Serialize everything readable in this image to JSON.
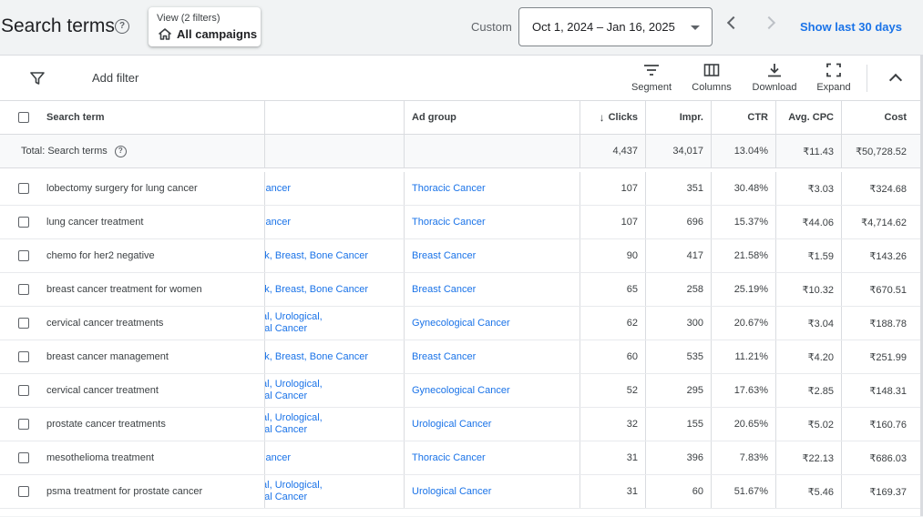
{
  "header": {
    "title": "Search terms",
    "help_glyph": "?",
    "view_label": "View (2 filters)",
    "view_value": "All campaigns",
    "custom_label": "Custom",
    "date_range": "Oct 1, 2024 – Jan 16, 2025",
    "show_last": "Show last 30 days"
  },
  "toolbar": {
    "add_filter": "Add filter",
    "segment": "Segment",
    "columns": "Columns",
    "download": "Download",
    "expand": "Expand"
  },
  "table": {
    "columns": {
      "search_term": "Search term",
      "ad_group": "Ad group",
      "clicks": "Clicks",
      "impr": "Impr.",
      "ctr": "CTR",
      "avg_cpc": "Avg. CPC",
      "cost": "Cost"
    },
    "sort_glyph": "↓",
    "total": {
      "label": "Total: Search terms",
      "clicks": "4,437",
      "impr": "34,017",
      "ctr": "13.04%",
      "avg_cpc": "₹11.43",
      "cost": "₹50,728.52"
    },
    "rows": [
      {
        "term": "lobectomy surgery for lung cancer",
        "camp1": "Cancer",
        "camp2": "",
        "ad_group": "Thoracic Cancer",
        "clicks": "107",
        "impr": "351",
        "ctr": "30.48%",
        "cpc": "₹3.03",
        "cost": "₹324.68"
      },
      {
        "term": "lung cancer treatment",
        "camp1": "Cancer",
        "camp2": "",
        "ad_group": "Thoracic Cancer",
        "clicks": "107",
        "impr": "696",
        "ctr": "15.37%",
        "cpc": "₹44.06",
        "cost": "₹4,714.62"
      },
      {
        "term": "chemo for her2 negative",
        "camp1": "eck, Breast, Bone Cancer",
        "camp2": "",
        "ad_group": "Breast Cancer",
        "clicks": "90",
        "impr": "417",
        "ctr": "21.58%",
        "cpc": "₹1.59",
        "cost": "₹143.26"
      },
      {
        "term": "breast cancer treatment for women",
        "camp1": "eck, Breast, Bone Cancer",
        "camp2": "",
        "ad_group": "Breast Cancer",
        "clicks": "65",
        "impr": "258",
        "ctr": "25.19%",
        "cpc": "₹10.32",
        "cost": "₹670.51"
      },
      {
        "term": "cervical cancer treatments",
        "camp1": "gical, Urological,",
        "camp2": "stinal Cancer",
        "ad_group": "Gynecological Cancer",
        "clicks": "62",
        "impr": "300",
        "ctr": "20.67%",
        "cpc": "₹3.04",
        "cost": "₹188.78"
      },
      {
        "term": "breast cancer management",
        "camp1": "eck, Breast, Bone Cancer",
        "camp2": "",
        "ad_group": "Breast Cancer",
        "clicks": "60",
        "impr": "535",
        "ctr": "11.21%",
        "cpc": "₹4.20",
        "cost": "₹251.99"
      },
      {
        "term": "cervical cancer treatment",
        "camp1": "gical, Urological,",
        "camp2": "stinal Cancer",
        "ad_group": "Gynecological Cancer",
        "clicks": "52",
        "impr": "295",
        "ctr": "17.63%",
        "cpc": "₹2.85",
        "cost": "₹148.31"
      },
      {
        "term": "prostate cancer treatments",
        "camp1": "gical, Urological,",
        "camp2": "stinal Cancer",
        "ad_group": "Urological Cancer",
        "clicks": "32",
        "impr": "155",
        "ctr": "20.65%",
        "cpc": "₹5.02",
        "cost": "₹160.76"
      },
      {
        "term": "mesothelioma treatment",
        "camp1": "Cancer",
        "camp2": "",
        "ad_group": "Thoracic Cancer",
        "clicks": "31",
        "impr": "396",
        "ctr": "7.83%",
        "cpc": "₹22.13",
        "cost": "₹686.03"
      },
      {
        "term": "psma treatment for prostate cancer",
        "camp1": "gical, Urological,",
        "camp2": "stinal Cancer",
        "ad_group": "Urological Cancer",
        "clicks": "31",
        "impr": "60",
        "ctr": "51.67%",
        "cpc": "₹5.46",
        "cost": "₹169.37"
      }
    ]
  },
  "colors": {
    "link": "#1a73e8",
    "background": "#f1f3f4",
    "border": "#dadce0"
  }
}
